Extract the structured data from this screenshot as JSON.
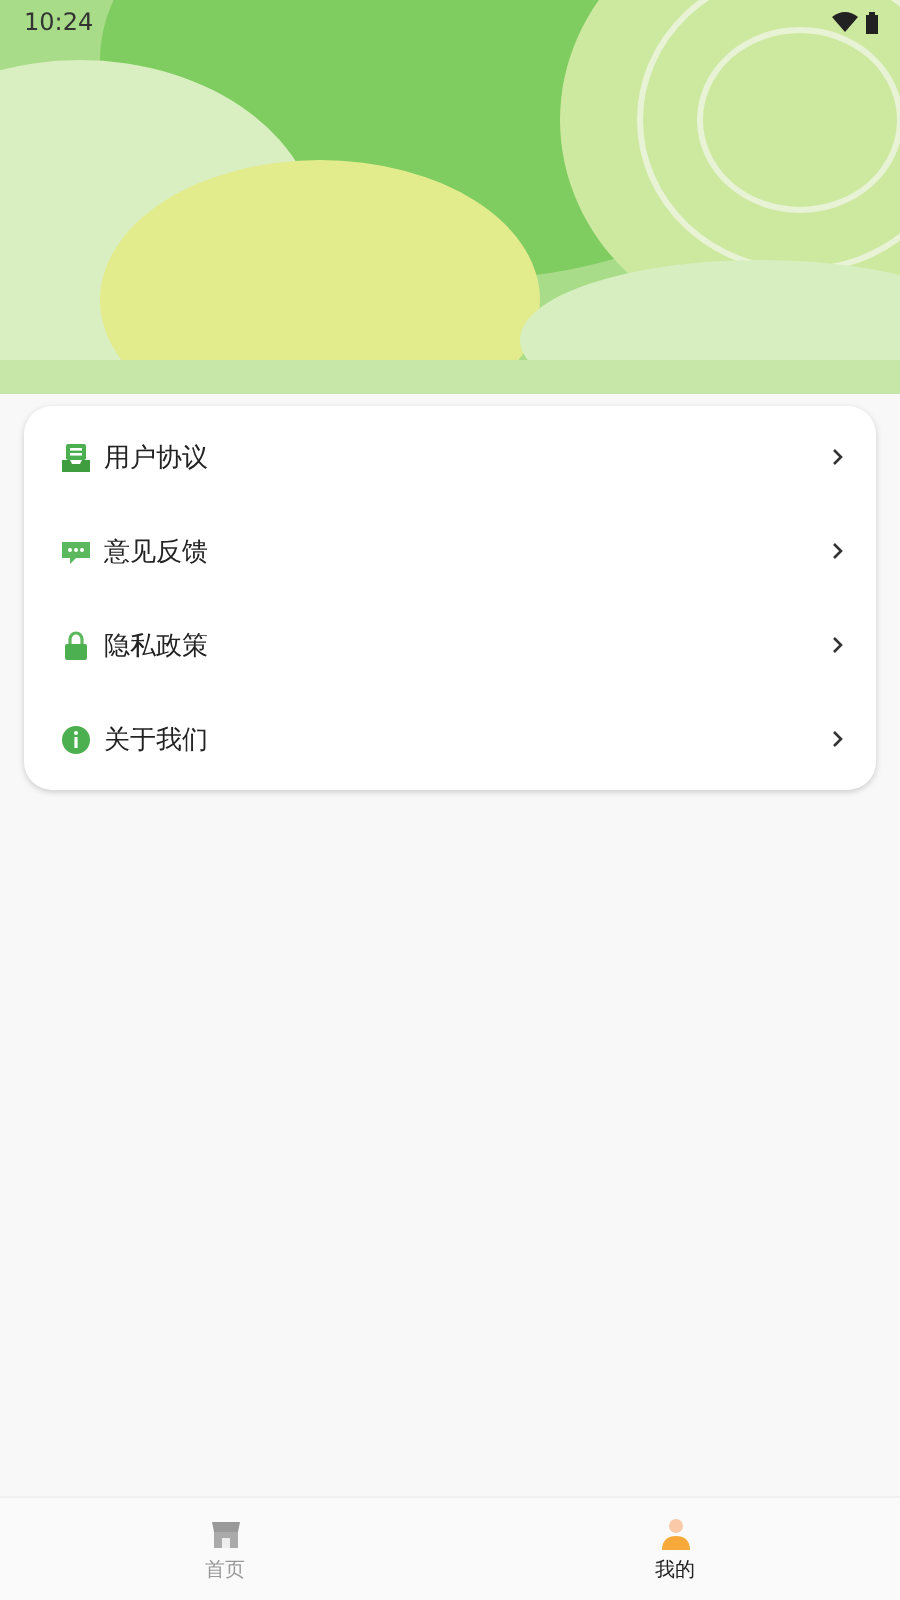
{
  "status_bar": {
    "time": "10:24"
  },
  "menu": [
    {
      "kind": "agreement",
      "label": "用户协议"
    },
    {
      "kind": "feedback",
      "label": "意见反馈"
    },
    {
      "kind": "privacy",
      "label": "隐私政策"
    },
    {
      "kind": "about",
      "label": "关于我们"
    }
  ],
  "tabs": [
    {
      "kind": "home",
      "label": "首页",
      "selected": false
    },
    {
      "kind": "mine",
      "label": "我的",
      "selected": true
    }
  ]
}
